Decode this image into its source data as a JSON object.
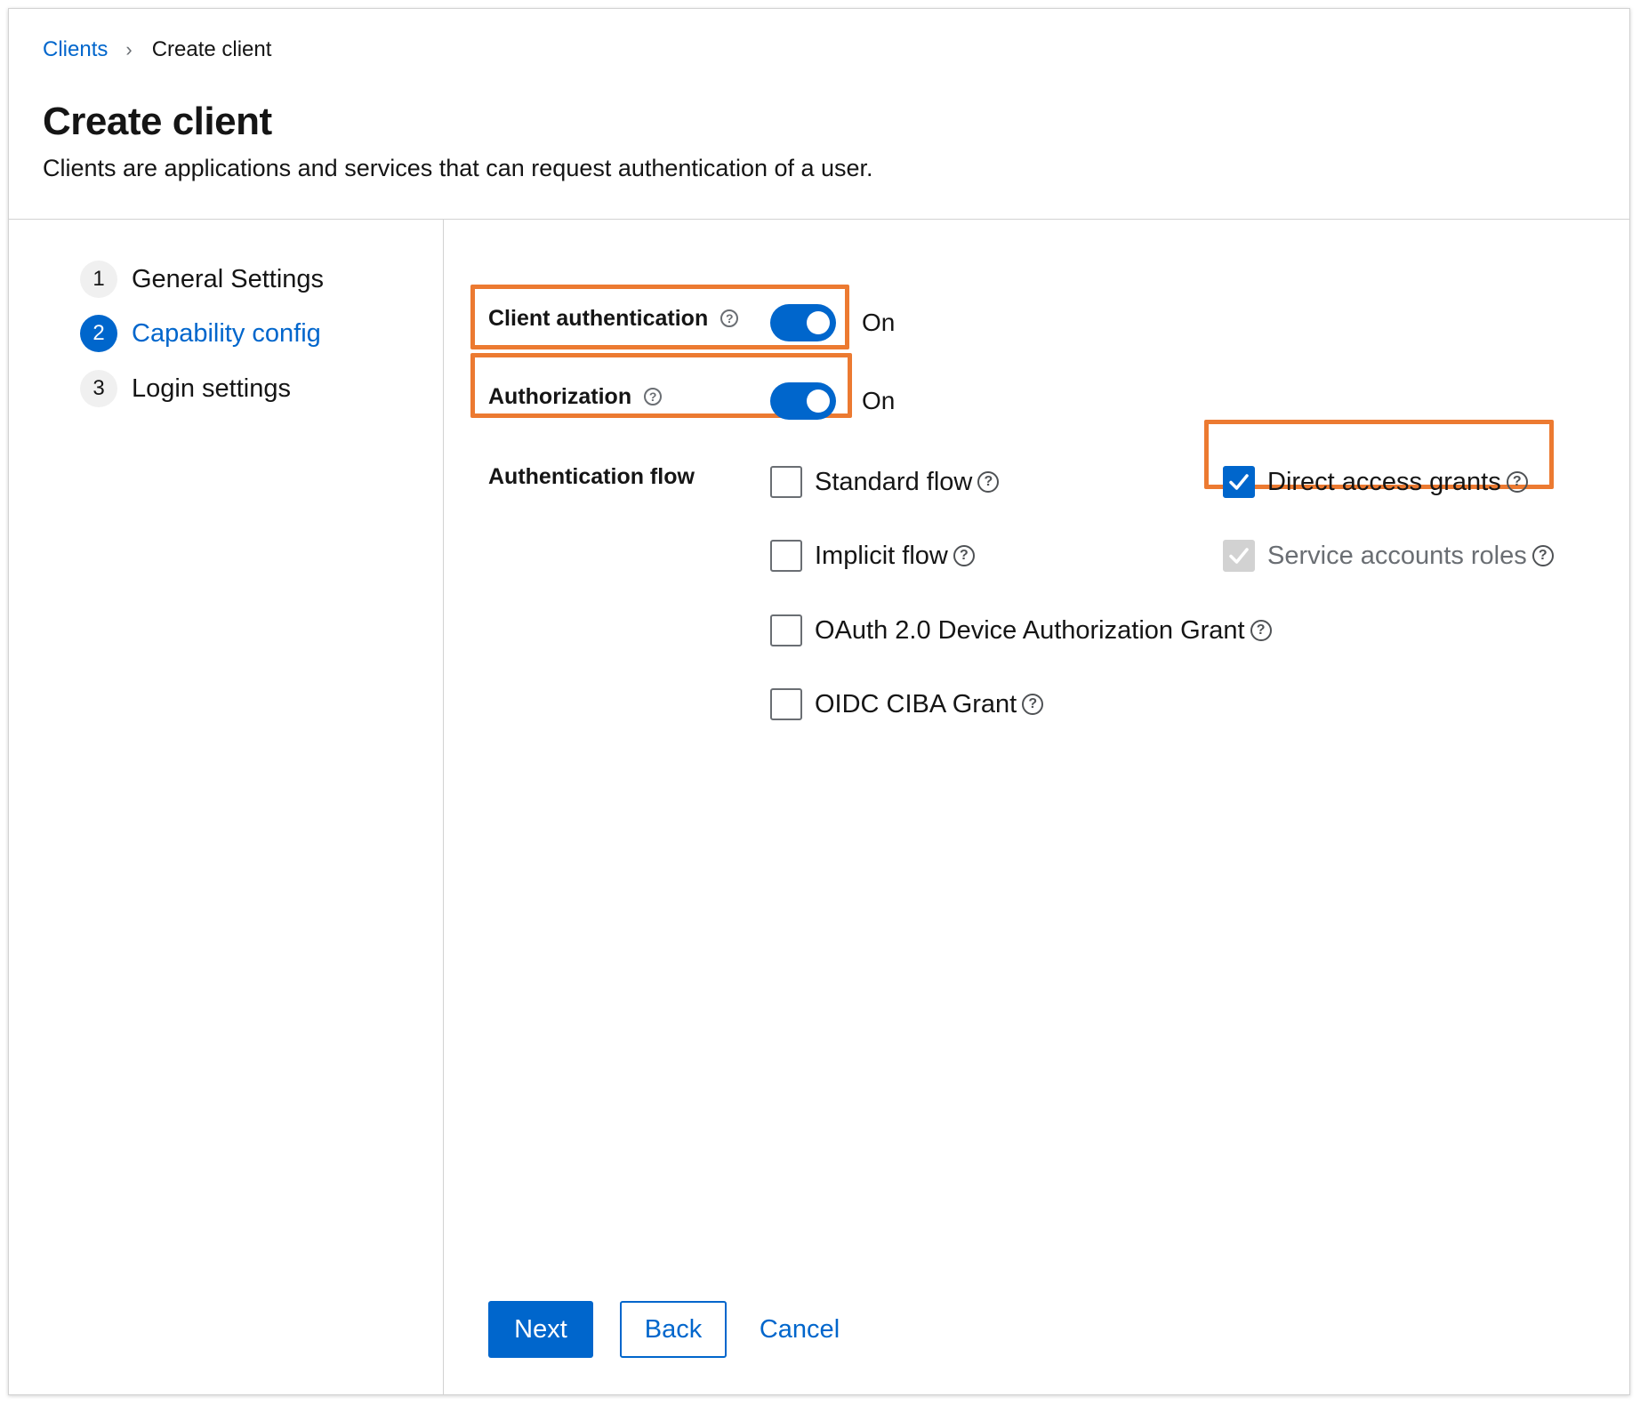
{
  "breadcrumb": {
    "parent": "Clients",
    "current": "Create client"
  },
  "header": {
    "title": "Create client",
    "description": "Clients are applications and services that can request authentication of a user."
  },
  "wizard": {
    "steps": [
      {
        "number": "1",
        "label": "General Settings",
        "active": false
      },
      {
        "number": "2",
        "label": "Capability config",
        "active": true
      },
      {
        "number": "3",
        "label": "Login settings",
        "active": false
      }
    ]
  },
  "form": {
    "client_authentication": {
      "label": "Client authentication",
      "state": "On",
      "enabled": true
    },
    "authorization": {
      "label": "Authorization",
      "state": "On",
      "enabled": true
    },
    "authentication_flow": {
      "label": "Authentication flow",
      "options": [
        {
          "label": "Standard flow",
          "checked": false,
          "disabled": false
        },
        {
          "label": "Implicit flow",
          "checked": false,
          "disabled": false
        },
        {
          "label": "OAuth 2.0 Device Authorization Grant",
          "checked": false,
          "disabled": false
        },
        {
          "label": "OIDC CIBA Grant",
          "checked": false,
          "disabled": false
        },
        {
          "label": "Direct access grants",
          "checked": true,
          "disabled": false
        },
        {
          "label": "Service accounts roles",
          "checked": true,
          "disabled": true
        }
      ]
    }
  },
  "footer": {
    "next": "Next",
    "back": "Back",
    "cancel": "Cancel"
  },
  "colors": {
    "accent": "#0066cc",
    "highlight": "#ec7a31"
  },
  "icons": {
    "help": "help-circle-icon",
    "breadcrumb_separator": "chevron-right-icon",
    "check": "checkmark-icon"
  }
}
